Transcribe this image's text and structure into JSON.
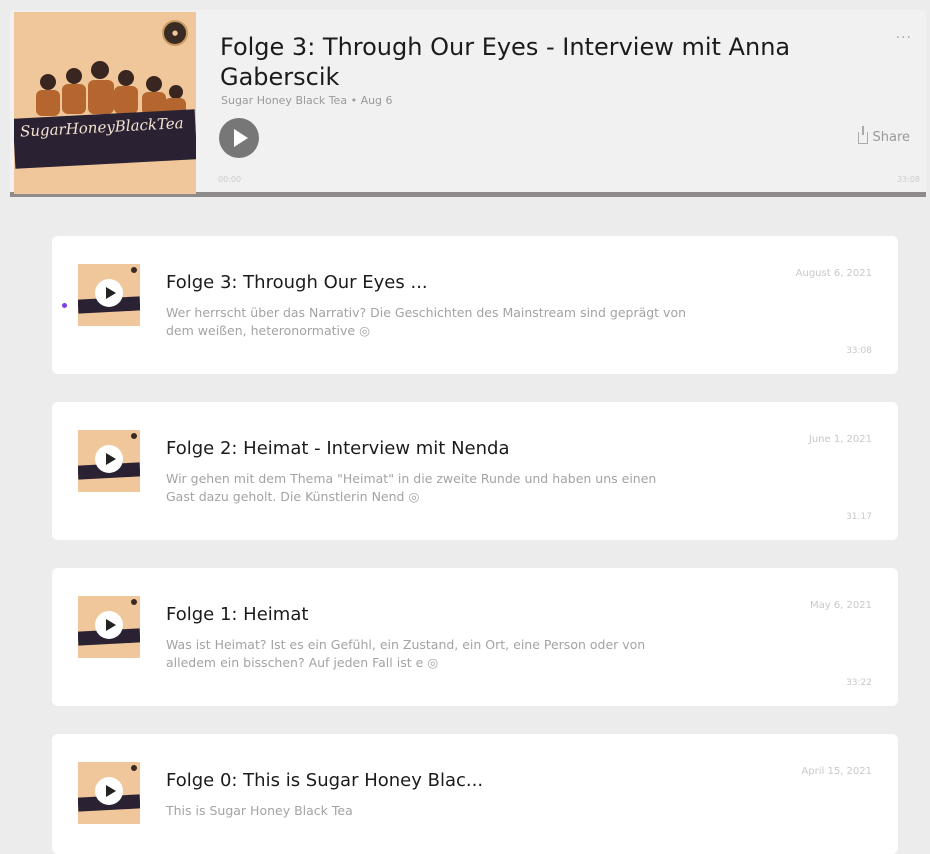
{
  "player": {
    "title": "Folge 3: Through Our Eyes - Interview mit Anna Gaberscik",
    "show": "Sugar Honey Black Tea",
    "date": "Aug 6",
    "share_label": "Share",
    "more_label": "···",
    "cover_logo": "SugarHoneyBlackTea",
    "time_current": "00:00",
    "time_total": "33:08"
  },
  "episodes": [
    {
      "title": "Folge 3: Through Our Eyes ...",
      "desc": "Wer herrscht über das Narrativ? Die Geschichten des Mainstream sind geprägt von dem weißen, heteronormative ◎",
      "date": "August 6, 2021",
      "duration": "33:08",
      "is_new": true
    },
    {
      "title": "Folge 2: Heimat - Interview mit Nenda",
      "desc": "Wir gehen mit dem Thema \"Heimat\" in die zweite Runde und haben uns einen Gast dazu geholt. Die Künstlerin Nend ◎",
      "date": "June 1, 2021",
      "duration": "31:17",
      "is_new": false
    },
    {
      "title": "Folge 1: Heimat",
      "desc": "Was ist Heimat? Ist es ein Gefühl, ein Zustand, ein Ort, eine Person oder von alledem ein bisschen? Auf jeden Fall ist e ◎",
      "date": "May 6, 2021",
      "duration": "33:22",
      "is_new": false
    },
    {
      "title": "Folge 0: This is Sugar Honey Blac...",
      "desc": "This is Sugar Honey Black Tea",
      "date": "April 15, 2021",
      "duration": "",
      "is_new": false
    }
  ],
  "colors": {
    "new_indicator": "#7b3fe4",
    "cover_bg": "#f0c79b",
    "progress_bar": "#8f8a8c"
  }
}
